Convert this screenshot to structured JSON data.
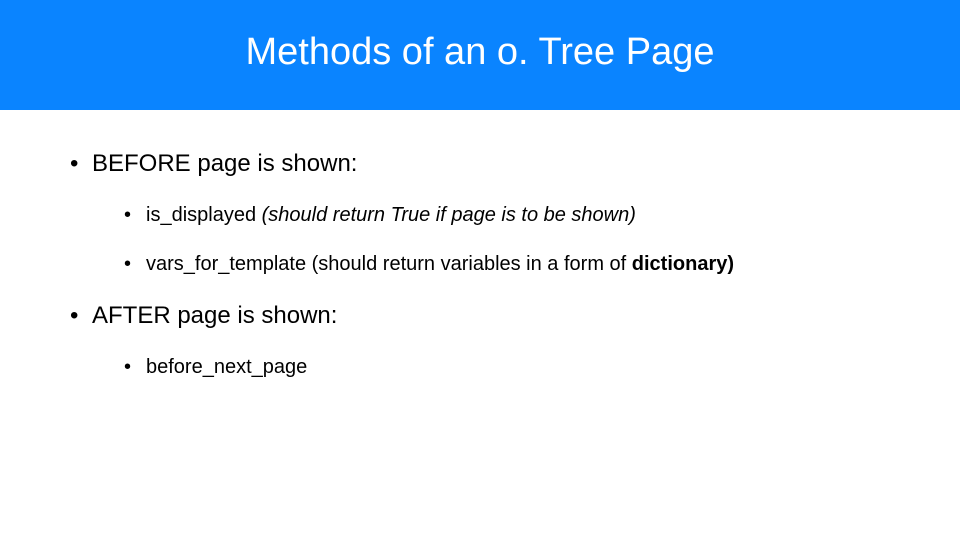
{
  "title": "Methods of an o. Tree Page",
  "sections": {
    "before": {
      "label": "BEFORE page is shown:",
      "items": {
        "is_displayed": {
          "method": "is_displayed",
          "note_italic": " (should return True if page is to be shown)"
        },
        "vars_for_template": {
          "method": "vars_for_template",
          "note_plain": " (should return variables in a form of ",
          "note_bold": "dictionary)"
        }
      }
    },
    "after": {
      "label": "AFTER page is shown:",
      "items": {
        "before_next_page": {
          "method": "before_next_page"
        }
      }
    }
  }
}
